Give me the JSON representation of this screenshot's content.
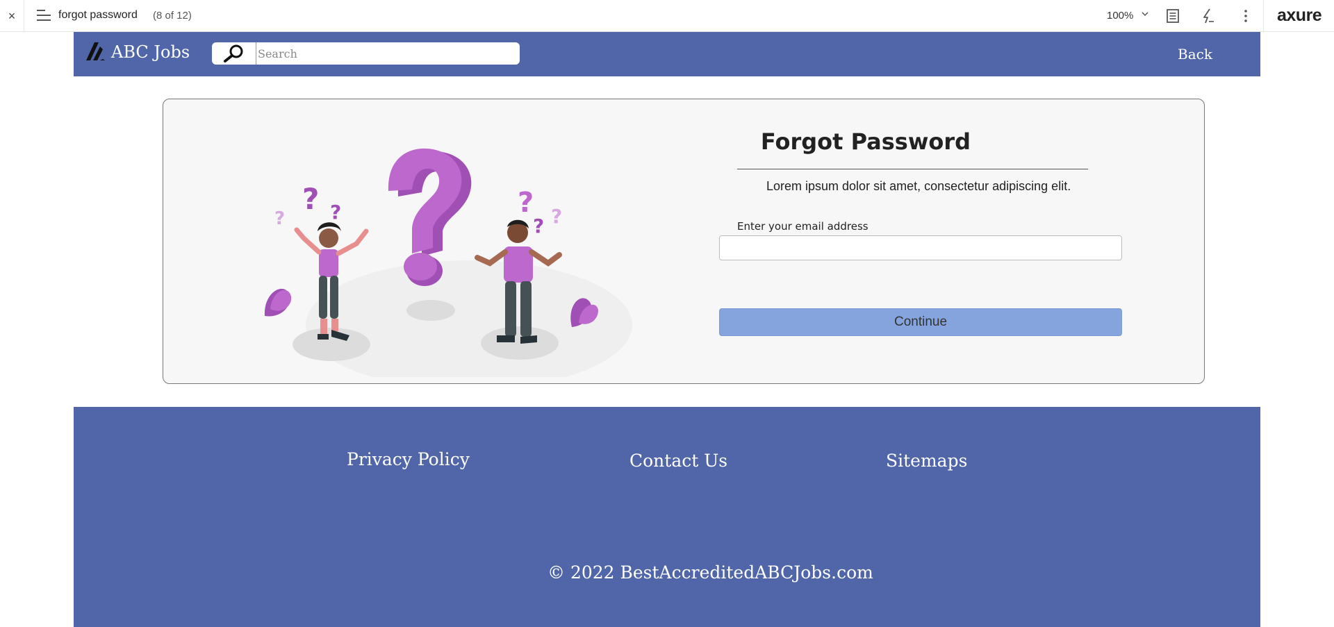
{
  "axure_bar": {
    "close_glyph": "×",
    "page_title": "forgot password",
    "page_count": "(8 of 12)",
    "zoom": "100%",
    "logo": "axure",
    "icons": [
      "close-icon",
      "menu-icon",
      "chevron-down-icon",
      "notes-icon",
      "interactions-icon",
      "more-icon"
    ]
  },
  "header": {
    "brand": "ABC Jobs",
    "search_placeholder": "Search",
    "back_label": "Back",
    "bg_color": "#5166a8"
  },
  "form": {
    "title": "Forgot Password",
    "description": "Lorem ipsum dolor sit amet, consectetur adipiscing elit.",
    "email_label": "Enter your email address",
    "email_value": "",
    "continue_label": "Continue",
    "button_color": "#85a4de"
  },
  "illustration": {
    "name": "confused-people-question-mark",
    "accent_color": "#b868c8"
  },
  "footer": {
    "links": [
      "Privacy Policy",
      "Contact Us",
      "Sitemaps"
    ],
    "copyright": "© 2022 BestAccreditedABCJobs.com",
    "bg_color": "#5166a8"
  }
}
